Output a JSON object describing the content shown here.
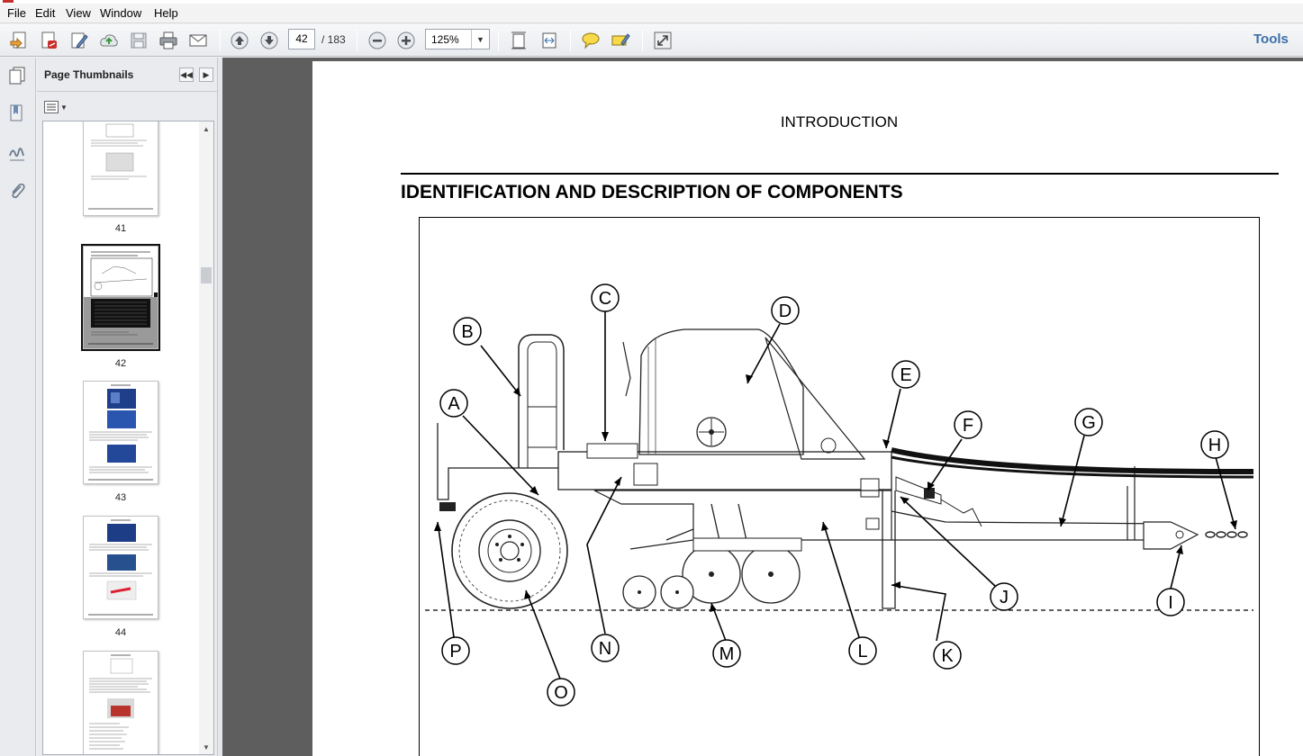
{
  "menu": {
    "items": [
      "File",
      "Edit",
      "View",
      "Window",
      "Help"
    ]
  },
  "toolbar": {
    "current_page": "42",
    "page_total": "/ 183",
    "zoom": "125%",
    "tools_label": "Tools",
    "icons": [
      "create-pdf-icon",
      "create-pdf-red-icon",
      "edit-icon",
      "upload-cloud-icon",
      "save-icon",
      "print-icon",
      "email-icon",
      "page-up-icon",
      "page-down-icon",
      "zoom-out-icon",
      "zoom-in-icon",
      "fit-page-icon",
      "fit-width-icon",
      "comment-icon",
      "highlight-icon",
      "full-screen-icon"
    ]
  },
  "sidebar": {
    "title": "Page Thumbnails",
    "thumbnails": [
      {
        "label": "41"
      },
      {
        "label": "42",
        "selected": true
      },
      {
        "label": "43"
      },
      {
        "label": "44"
      },
      {
        "label": ""
      }
    ]
  },
  "document": {
    "header": "INTRODUCTION",
    "section_title": "IDENTIFICATION AND DESCRIPTION OF COMPONENTS",
    "callouts": [
      "A",
      "B",
      "C",
      "D",
      "E",
      "F",
      "G",
      "H",
      "I",
      "J",
      "K",
      "L",
      "M",
      "N",
      "O",
      "P"
    ]
  }
}
